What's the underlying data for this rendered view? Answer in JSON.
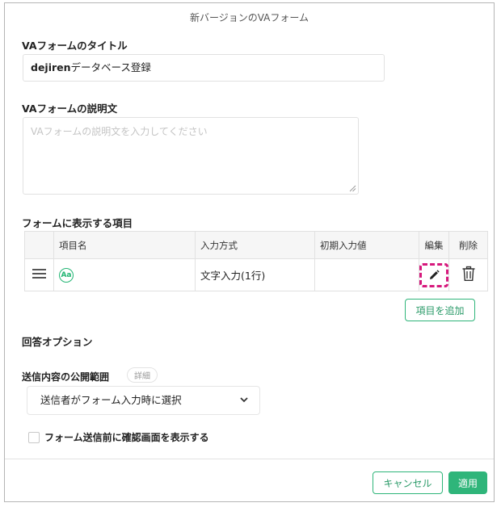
{
  "dialog": {
    "title": "新バージョンのVAフォーム"
  },
  "form_title": {
    "label": "VAフォームのタイトル",
    "value_latin": "dejiren",
    "value_rest": "データベース登録"
  },
  "form_description": {
    "label": "VAフォームの説明文",
    "placeholder": "VAフォームの説明文を入力してください"
  },
  "items_section": {
    "label": "フォームに表示する項目",
    "headers": {
      "drag": "",
      "name": "項目名",
      "input_type": "入力方式",
      "initial_value": "初期入力値",
      "edit": "編集",
      "delete": "削除"
    },
    "rows": [
      {
        "name_icon": "Aa",
        "input_type": "文字入力(1行)",
        "initial_value": ""
      }
    ],
    "add_button": "項目を追加"
  },
  "answer_options": {
    "label": "回答オプション",
    "visibility_label": "送信内容の公開範囲",
    "detail_badge": "詳細",
    "visibility_selected": "送信者がフォーム入力時に選択",
    "confirm_label": "フォーム送信前に確認画面を表示する",
    "confirm_checked": false
  },
  "footer": {
    "cancel": "キャンセル",
    "apply": "適用"
  },
  "colors": {
    "accent": "#2fb57a",
    "highlight": "#d6187c"
  }
}
